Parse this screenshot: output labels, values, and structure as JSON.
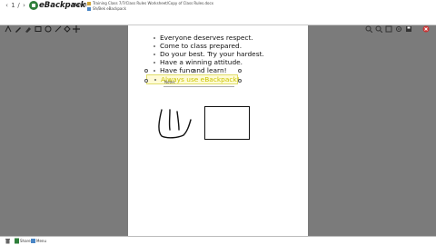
{
  "app": {
    "logo_text": "eBackpack",
    "logo_sub": "Markit"
  },
  "breadcrumb": {
    "path": "Training Class 7/7/Class Rules Worksheet/Copy of Class Rules.docx",
    "sub": "Sh/Bek eBackpack"
  },
  "nav": {
    "back": "‹",
    "page_indicator": "1",
    "divider": "/",
    "forward": "›"
  },
  "document": {
    "bullets": [
      "Everyone deserves respect.",
      "Come to class prepared.",
      "Do your best.  Try your hardest.",
      "Have a winning attitude.",
      "Have fun and learn!"
    ],
    "highlighted_bullet": "Always use eBackpack!",
    "note_label": "Notes"
  },
  "bottom": {
    "label_a": "Share",
    "label_b": "Menu"
  },
  "colors": {
    "highlight_text": "#c9c400",
    "page_bg": "#ffffff",
    "canvas_bg": "#7b7b7b"
  }
}
